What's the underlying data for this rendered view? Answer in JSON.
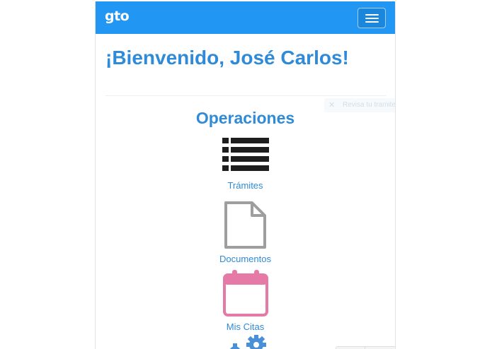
{
  "app": {
    "brand": "gto"
  },
  "header": {
    "menu_button": "menu-toggle"
  },
  "main": {
    "welcome": "¡Bienvenido, José Carlos!",
    "section_title": "Operaciones",
    "operations": [
      {
        "label": "Trámites",
        "icon": "list-icon",
        "color": "#1e1e1e"
      },
      {
        "label": "Documentos",
        "icon": "document-icon",
        "color": "#9e9e9e"
      },
      {
        "label": "Mis Citas",
        "icon": "calendar-icon",
        "color": "#e67aa6"
      },
      {
        "label": "",
        "icon": "gears-icon",
        "color": "#4a90d9"
      }
    ]
  },
  "ghost_popup": {
    "text": "Revisa tu tramite"
  },
  "colors": {
    "navbar": "#2196f3",
    "accent": "#2f8ad8"
  }
}
